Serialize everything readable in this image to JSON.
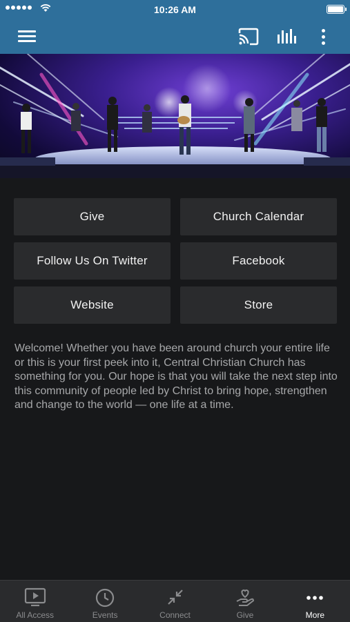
{
  "status_bar": {
    "time": "10:26 AM"
  },
  "app_bar": {
    "menu_icon": "hamburger-menu-icon",
    "cast_icon": "cast-icon",
    "audio_icon": "audio-bars-icon",
    "more_icon": "vertical-dots-icon",
    "color": "#2e6f9b"
  },
  "hero": {
    "icon": "worship-stage-photo"
  },
  "links": [
    {
      "label": "Give"
    },
    {
      "label": "Church Calendar"
    },
    {
      "label": "Follow Us On Twitter"
    },
    {
      "label": "Facebook"
    },
    {
      "label": "Website"
    },
    {
      "label": "Store"
    }
  ],
  "welcome_text": "Welcome! Whether you have been around church your entire life or this is your first peek into it, Central Christian Church has something for you. Our hope is that you will take the next step into this community of people led by Christ to bring hope, strengthen and change to the world — one life at a time.",
  "tabs": [
    {
      "label": "All Access",
      "icon": "tv-play-icon",
      "active": false
    },
    {
      "label": "Events",
      "icon": "clock-icon",
      "active": false
    },
    {
      "label": "Connect",
      "icon": "arrows-inward-icon",
      "active": false
    },
    {
      "label": "Give",
      "icon": "heart-hand-icon",
      "active": false
    },
    {
      "label": "More",
      "icon": "horizontal-dots-icon",
      "active": true
    }
  ],
  "colors": {
    "background": "#17181a",
    "button": "#2a2b2d",
    "tab_bar": "#2a2b2d"
  }
}
